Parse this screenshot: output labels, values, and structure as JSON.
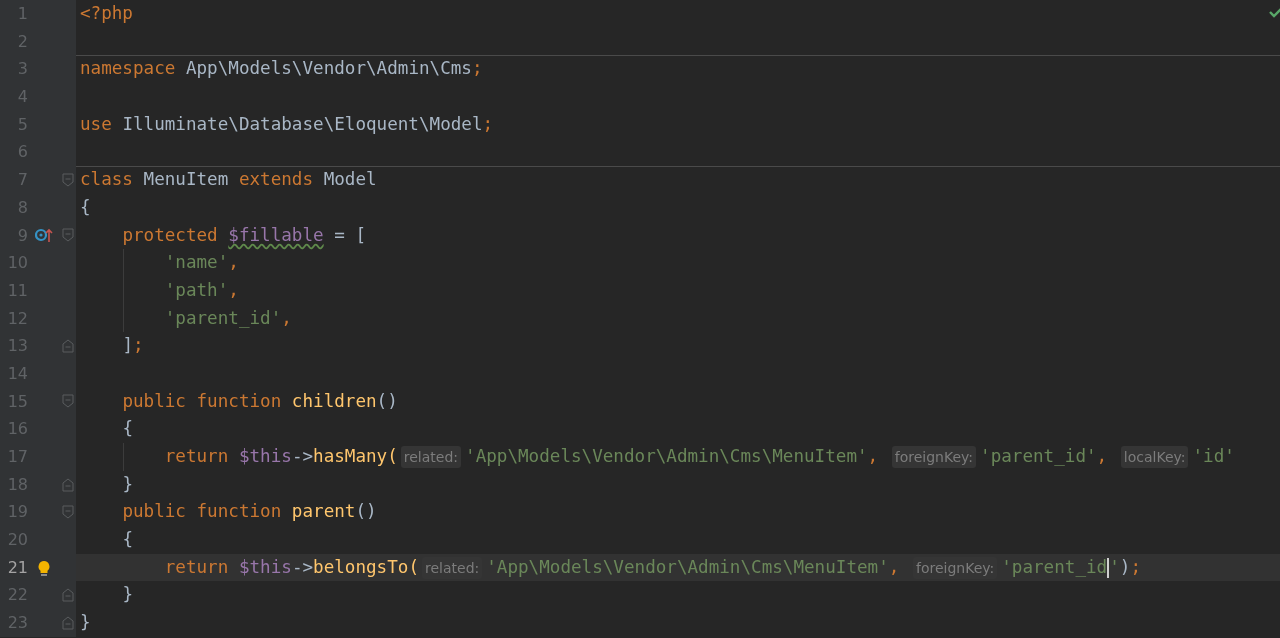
{
  "editor": {
    "lines": [
      {
        "number": "1",
        "current": false,
        "tokens": [
          {
            "kind": "keyword",
            "text": "<?php"
          }
        ]
      },
      {
        "number": "2",
        "current": false
      },
      {
        "number": "3",
        "current": false,
        "separator_above": true,
        "tokens": [
          {
            "kind": "keyword",
            "text": "namespace"
          },
          {
            "kind": "text",
            "text": " App\\Models\\Vendor\\Admin\\Cms"
          },
          {
            "kind": "punct",
            "text": ";"
          }
        ]
      },
      {
        "number": "4",
        "current": false
      },
      {
        "number": "5",
        "current": false,
        "tokens": [
          {
            "kind": "keyword",
            "text": "use"
          },
          {
            "kind": "text",
            "text": " Illuminate\\Database\\Eloquent\\Model"
          },
          {
            "kind": "punct",
            "text": ";"
          }
        ]
      },
      {
        "number": "6",
        "current": false
      },
      {
        "number": "7",
        "current": false,
        "separator_above": true,
        "gutter": [
          {
            "kind": "fold_start"
          }
        ],
        "tokens": [
          {
            "kind": "keyword",
            "text": "class"
          },
          {
            "kind": "text",
            "text": " MenuItem "
          },
          {
            "kind": "keyword",
            "text": "extends"
          },
          {
            "kind": "text",
            "text": " Model"
          }
        ]
      },
      {
        "number": "8",
        "current": false,
        "tokens": [
          {
            "kind": "text",
            "text": "{"
          }
        ]
      },
      {
        "number": "9",
        "current": false,
        "gutter": [
          {
            "kind": "override"
          },
          {
            "kind": "fold_start"
          }
        ],
        "tokens": [
          {
            "kind": "keyword",
            "text": "    protected"
          },
          {
            "kind": "unused_variable",
            "text": " $fillable"
          },
          {
            "kind": "text",
            "text": " = ["
          }
        ]
      },
      {
        "number": "10",
        "current": false,
        "guide": true,
        "tokens": [
          {
            "kind": "string",
            "text": "        'name'"
          },
          {
            "kind": "punct",
            "text": ","
          }
        ]
      },
      {
        "number": "11",
        "current": false,
        "guide": true,
        "tokens": [
          {
            "kind": "string",
            "text": "        'path'"
          },
          {
            "kind": "punct",
            "text": ","
          }
        ]
      },
      {
        "number": "12",
        "current": false,
        "guide": true,
        "tokens": [
          {
            "kind": "string",
            "text": "        'parent_id'"
          },
          {
            "kind": "punct",
            "text": ","
          }
        ]
      },
      {
        "number": "13",
        "current": false,
        "gutter": [
          {
            "kind": "fold_end"
          }
        ],
        "tokens": [
          {
            "kind": "text",
            "text": "    ]"
          },
          {
            "kind": "punct",
            "text": ";"
          }
        ]
      },
      {
        "number": "14",
        "current": false
      },
      {
        "number": "15",
        "current": false,
        "gutter": [
          {
            "kind": "fold_start"
          }
        ],
        "tokens": [
          {
            "kind": "keyword",
            "text": "    public function"
          },
          {
            "kind": "function",
            "text": " children"
          },
          {
            "kind": "text",
            "text": "()"
          }
        ]
      },
      {
        "number": "16",
        "current": false,
        "tokens": [
          {
            "kind": "text",
            "text": "    {"
          }
        ]
      },
      {
        "number": "17",
        "current": false,
        "guide": true,
        "tokens": [
          {
            "kind": "keyword",
            "text": "        return"
          },
          {
            "kind": "variable",
            "text": " $this"
          },
          {
            "kind": "text",
            "text": "->"
          },
          {
            "kind": "function",
            "text": "hasMany("
          },
          {
            "kind": "hint",
            "text": "related:"
          },
          {
            "kind": "string",
            "text": "'App\\Models\\Vendor\\Admin\\Cms\\MenuItem'"
          },
          {
            "kind": "punct",
            "text": ", "
          },
          {
            "kind": "hint",
            "text": "foreignKey:"
          },
          {
            "kind": "string",
            "text": "'parent_id'"
          },
          {
            "kind": "punct",
            "text": ", "
          },
          {
            "kind": "hint",
            "text": "localKey:"
          },
          {
            "kind": "string",
            "text": "'id'"
          }
        ]
      },
      {
        "number": "18",
        "current": false,
        "gutter": [
          {
            "kind": "fold_end"
          }
        ],
        "tokens": [
          {
            "kind": "text",
            "text": "    }"
          }
        ]
      },
      {
        "number": "19",
        "current": false,
        "gutter": [
          {
            "kind": "fold_start"
          }
        ],
        "tokens": [
          {
            "kind": "keyword",
            "text": "    public function"
          },
          {
            "kind": "function",
            "text": " parent"
          },
          {
            "kind": "text",
            "text": "()"
          }
        ]
      },
      {
        "number": "20",
        "current": false,
        "tokens": [
          {
            "kind": "text",
            "text": "    {"
          }
        ]
      },
      {
        "number": "21",
        "current": true,
        "gutter": [
          {
            "kind": "intention"
          }
        ],
        "tokens": [
          {
            "kind": "keyword",
            "text": "        return"
          },
          {
            "kind": "variable",
            "text": " $this"
          },
          {
            "kind": "text",
            "text": "->"
          },
          {
            "kind": "function",
            "text": "belongsTo("
          },
          {
            "kind": "hint",
            "text": "related:"
          },
          {
            "kind": "string",
            "text": "'App\\Models\\Vendor\\Admin\\Cms\\MenuItem'"
          },
          {
            "kind": "punct",
            "text": ", "
          },
          {
            "kind": "hint",
            "text": "foreignKey:"
          },
          {
            "kind": "string",
            "text": "'parent_id"
          },
          {
            "kind": "caret"
          },
          {
            "kind": "string",
            "text": "'"
          },
          {
            "kind": "text",
            "text": ")"
          },
          {
            "kind": "punct",
            "text": ";"
          }
        ]
      },
      {
        "number": "22",
        "current": false,
        "gutter": [
          {
            "kind": "fold_end"
          }
        ],
        "tokens": [
          {
            "kind": "text",
            "text": "    }"
          }
        ]
      },
      {
        "number": "23",
        "current": false,
        "gutter": [
          {
            "kind": "fold_end"
          }
        ],
        "tokens": [
          {
            "kind": "text",
            "text": "}"
          }
        ]
      }
    ]
  }
}
